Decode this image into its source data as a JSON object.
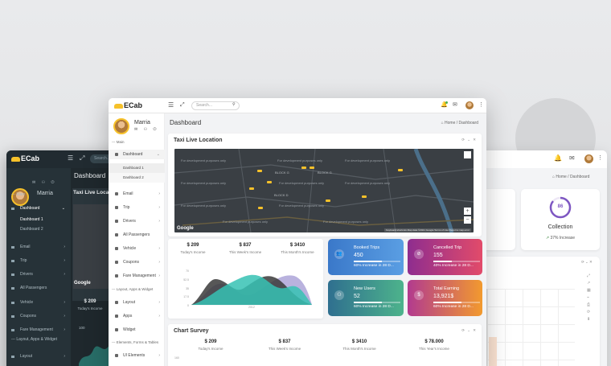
{
  "app": {
    "brand": "ECab",
    "search_placeholder": "Search...",
    "page_title": "Dashboard",
    "breadcrumb": {
      "home": "Home",
      "sep": "/",
      "current": "Dashboard"
    }
  },
  "user": {
    "name": "Marria"
  },
  "sidebar": {
    "section_main": "--- Main",
    "items": [
      {
        "label": "Dashboard",
        "expanded": true
      },
      {
        "label": "Email"
      },
      {
        "label": "Trip"
      },
      {
        "label": "Drivers"
      },
      {
        "label": "All Passengers"
      },
      {
        "label": "Vehicle"
      },
      {
        "label": "Coupons"
      },
      {
        "label": "Fare Management"
      }
    ],
    "sub_items": [
      "Dashboard 1",
      "Dashboard 2"
    ],
    "section_layout": "--- Layout, Apps & Widget",
    "layout_items": [
      {
        "label": "Layout"
      },
      {
        "label": "Apps"
      },
      {
        "label": "Widget"
      }
    ],
    "section_elements": "--- Elements, Forms & Tables",
    "element_items": [
      {
        "label": "UI Elements"
      }
    ]
  },
  "dark_window": {
    "brand": "ECab",
    "user": "Marria",
    "section_main": "--- Main",
    "items": [
      "Dashboard",
      "Email",
      "Trip",
      "Drivers",
      "All Passengers",
      "Vehicle",
      "Coupons",
      "Fare Management"
    ],
    "sub_items": [
      "Dashboard 1",
      "Dashboard 2"
    ],
    "section_layout": "--- Layout, Apps & Widget",
    "layout_item": "Layout",
    "title": "Dashboard",
    "card_title": "Taxi Live Locati",
    "stat_value": "$ 209",
    "stat_label": "Today's Income",
    "axis_value": "100",
    "map_google": "Google"
  },
  "map_card": {
    "title": "Taxi Live Location",
    "dev_text": "For development purposes only",
    "google": "Google",
    "attribution": "Keyboard shortcuts  Map data ©2021 Google  Terms of Use  Report a map error",
    "zoom_in": "+",
    "zoom_out": "−",
    "places": [
      "BLOCK G",
      "BLOCK G",
      "BLOCK D"
    ]
  },
  "income": {
    "stats": [
      {
        "value": "$ 209",
        "label": "Today's Income"
      },
      {
        "value": "$ 837",
        "label": "This Week's Income"
      },
      {
        "value": "$ 3410",
        "label": "This Month's Income"
      }
    ],
    "y_ticks": [
      "70",
      "52.5",
      "35",
      "17.5",
      "0"
    ],
    "x_label": "2012"
  },
  "stat_cards": [
    {
      "label": "Booked Trips",
      "value": "450",
      "foot": "60% Increase in 28 D...",
      "progress": 0.6,
      "icon": "users-icon",
      "colors": [
        "#3a78c9",
        "#5a9ee3"
      ]
    },
    {
      "label": "Cancelled Trip",
      "value": "155",
      "foot": "40% Increase in 28 D...",
      "progress": 0.4,
      "icon": "cancel-icon",
      "colors": [
        "#8e2d8f",
        "#e24b6a"
      ]
    },
    {
      "label": "New Users",
      "value": "52",
      "foot": "60% Increase in 28 D...",
      "progress": 0.6,
      "icon": "user-add-icon",
      "colors": [
        "#2f6f8f",
        "#4db38c"
      ]
    },
    {
      "label": "Total Earning",
      "value": "13,921$",
      "foot": "60% Increase in 28 D...",
      "progress": 0.6,
      "icon": "dollar-icon",
      "colors": [
        "#b23a8f",
        "#f29a2e"
      ]
    }
  ],
  "survey": {
    "title": "Chart Survey",
    "stats": [
      {
        "value": "$ 209",
        "label": "Today's Income"
      },
      {
        "value": "$ 837",
        "label": "This Week's Income"
      },
      {
        "value": "$ 3410",
        "label": "This Month's Income"
      },
      {
        "value": "$ 78.000",
        "label": "This Year's Income"
      }
    ],
    "y_tick": "160"
  },
  "right_window": {
    "breadcrumb_home": "Home",
    "breadcrumb_current": "Dashboard",
    "collection_value": "86",
    "collection_label": "Collection",
    "collection_foot": "37% Increase",
    "partial_foot": "se"
  },
  "colors": {
    "accent": "#f6c12a",
    "teal": "#36c2b4",
    "purple": "#a88fd0",
    "dark": "#263238"
  }
}
